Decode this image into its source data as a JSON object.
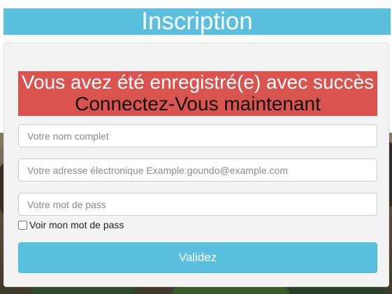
{
  "page": {
    "title": "Inscription"
  },
  "alert": {
    "message": "Vous avez été enregistré(e) avec succès",
    "link_text": "Connectez-Vous maintenant"
  },
  "form": {
    "fullname_placeholder": "Votre nom complet",
    "email_placeholder": "Votre adresse électronique Example:goundo@example.com",
    "password_placeholder": "Votre mot de pass",
    "show_password_label": "Voir mon mot de pass",
    "submit_label": "Validez"
  },
  "colors": {
    "title_bar": "#5bc0de",
    "alert_bg": "#d9534f",
    "submit_bg": "#5bc0de"
  }
}
